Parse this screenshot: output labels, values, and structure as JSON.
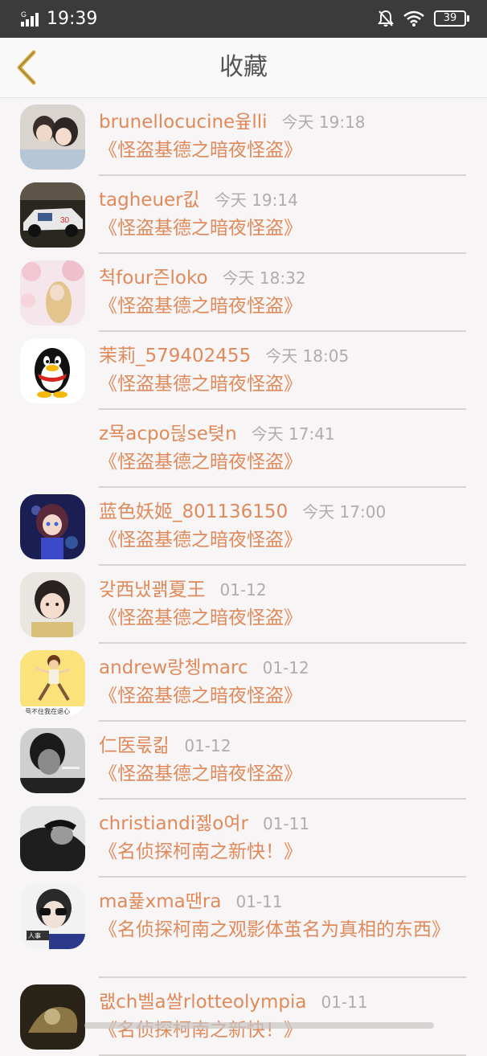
{
  "status": {
    "time": "19:39",
    "network": "G",
    "battery": "39"
  },
  "header": {
    "title": "收藏"
  },
  "items": [
    {
      "name": "brunellocucine윺lli",
      "time": "今天 19:18",
      "title": "《怪盗基德之暗夜怪盗》",
      "avatar": "couple-photo"
    },
    {
      "name": "tagheuer킶",
      "time": "今天 19:14",
      "title": "《怪盗基德之暗夜怪盗》",
      "avatar": "racecar-photo"
    },
    {
      "name": "척four즌loko",
      "time": "今天 18:32",
      "title": "《怪盗基德之暗夜怪盗》",
      "avatar": "blossom-photo"
    },
    {
      "name": "茉莉_579402455",
      "time": "今天 18:05",
      "title": "《怪盗基德之暗夜怪盗》",
      "avatar": "penguin-default"
    },
    {
      "name": "z묙acpo듾se텾n",
      "time": "今天 17:41",
      "title": "《怪盗基德之暗夜怪盗》",
      "avatar": "none"
    },
    {
      "name": "蓝色妖姬_801136150",
      "time": "今天 17:00",
      "title": "《怪盗基德之暗夜怪盗》",
      "avatar": "anime-girl"
    },
    {
      "name": "갖西냈괡夏王",
      "time": "01-12",
      "title": "《怪盗基德之暗夜怪盗》",
      "avatar": "child-photo"
    },
    {
      "name": "andrew랑쳉marc",
      "time": "01-12",
      "title": "《怪盗基德之暗夜怪盗》",
      "avatar": "cartoon-sticker"
    },
    {
      "name": "仁医룫킮",
      "time": "01-12",
      "title": "《怪盗基德之暗夜怪盗》",
      "avatar": "bw-portrait"
    },
    {
      "name": "christiandi졣o여r",
      "time": "01-11",
      "title": "《名侦探柯南之新快！》",
      "avatar": "bw-profile"
    },
    {
      "name": "ma퓵xma땐ra",
      "time": "01-11",
      "title": "《名侦探柯南之观影体茧名为真相的东西》",
      "avatar": "sunglasses-person"
    },
    {
      "name": "랪ch벨a쌀rlotteolympia",
      "time": "01-11",
      "title": "《名侦探柯南之新快！》",
      "avatar": "dark-photo"
    }
  ],
  "colors": {
    "accent": "#e08a5b",
    "time": "#b0acac",
    "divider": "#d6d3d3",
    "statusbar": "#3b3b3b",
    "back_arrow": "#d8b24a"
  }
}
